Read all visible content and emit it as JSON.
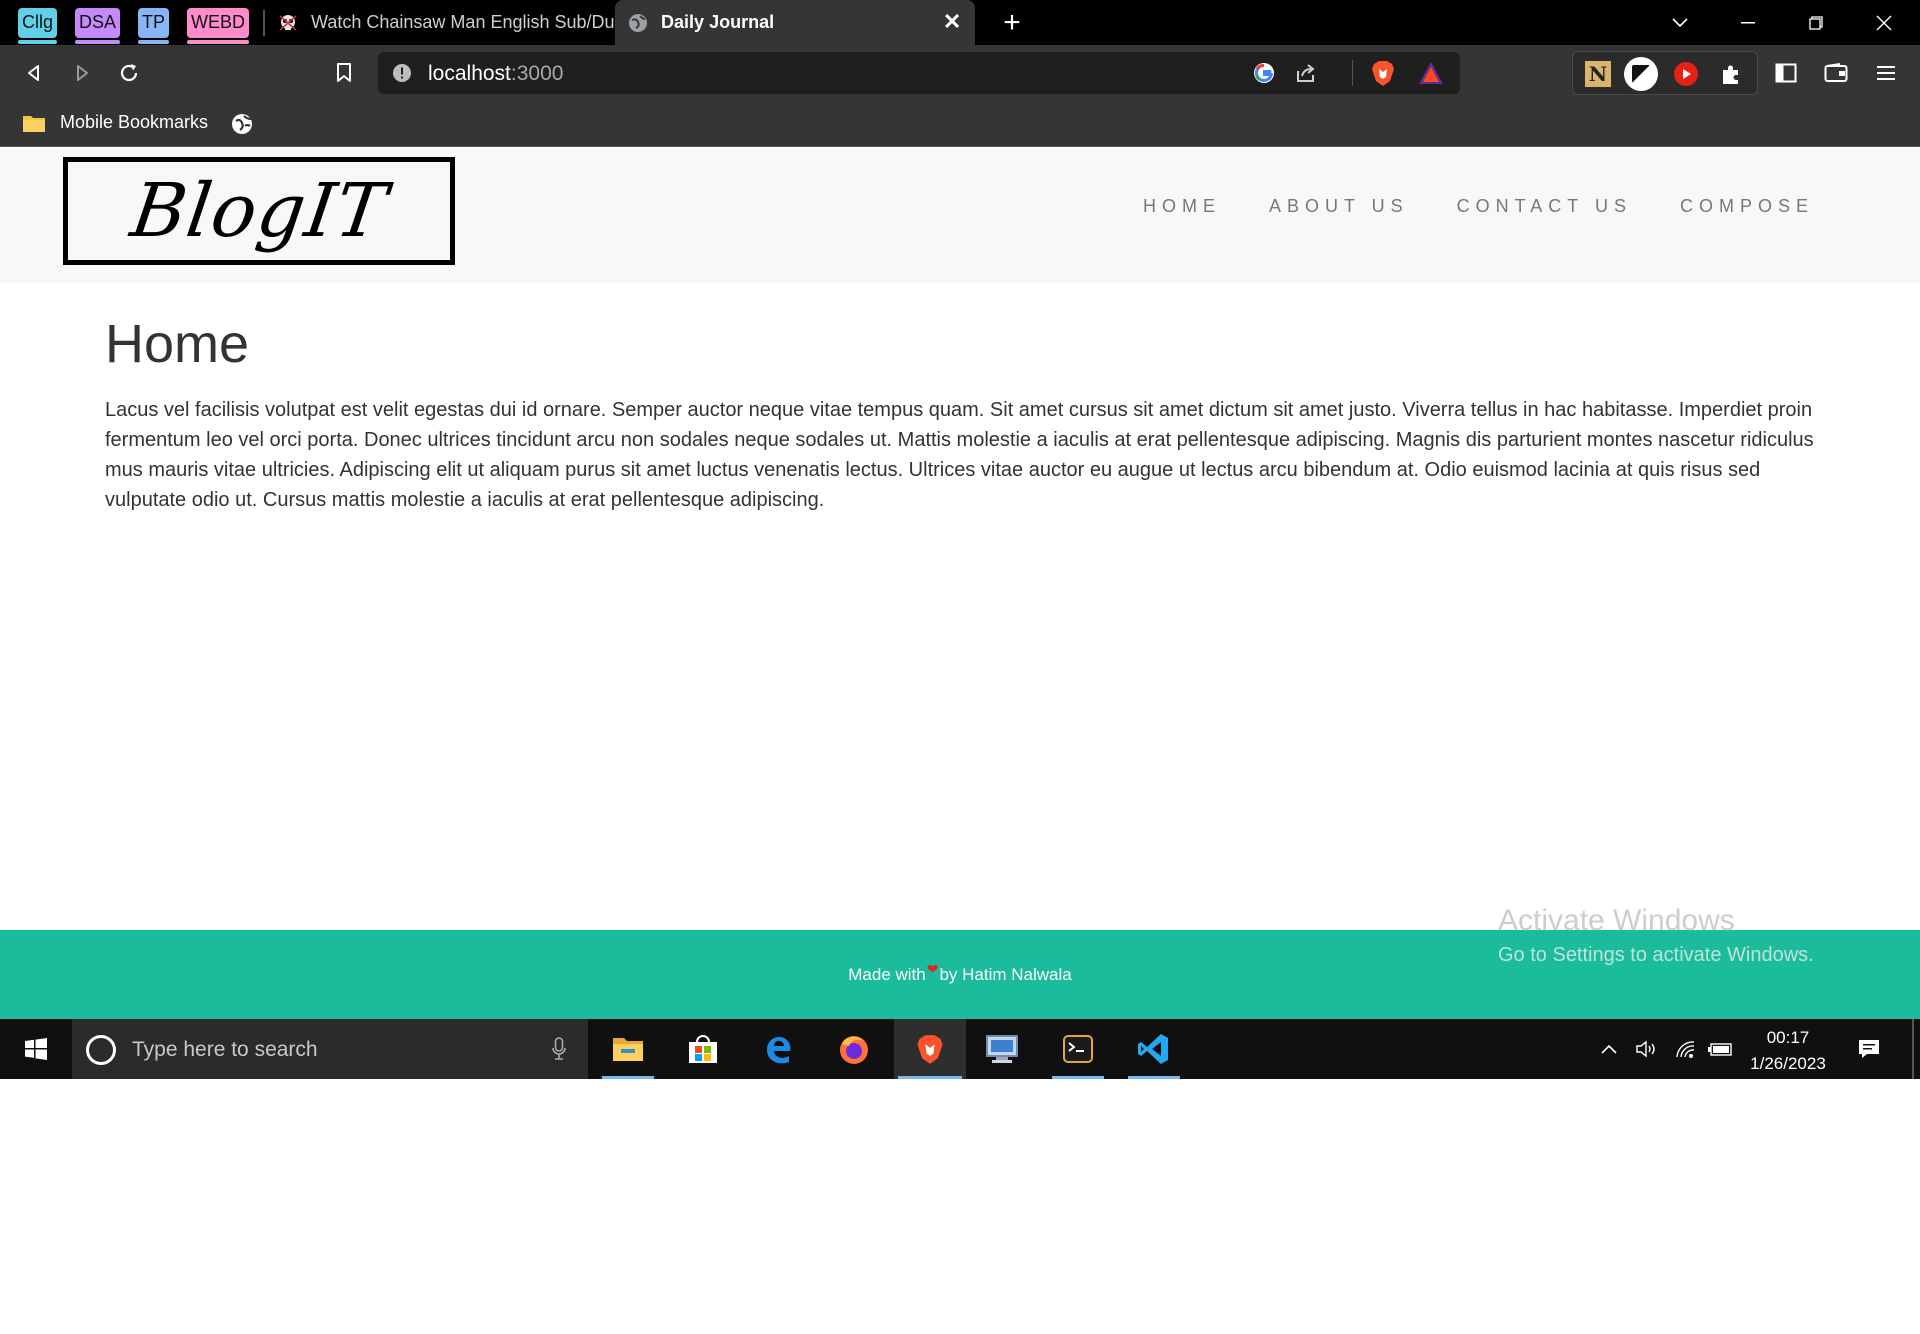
{
  "browser": {
    "tab_groups": [
      {
        "label": "Cllg",
        "color": "#5fd0e8"
      },
      {
        "label": "DSA",
        "color": "#c58af9"
      },
      {
        "label": "TP",
        "color": "#8ab4f8"
      },
      {
        "label": "WEBD",
        "color": "#ff8bcb"
      }
    ],
    "tabs": [
      {
        "title": "Watch Chainsaw Man English Sub/Dub",
        "active": false
      },
      {
        "title": "Daily Journal",
        "active": true
      }
    ],
    "address": {
      "host": "localhost",
      "port": ":3000"
    },
    "bookmarks": [
      {
        "label": "Mobile Bookmarks"
      }
    ]
  },
  "page": {
    "brand": "BlogIT",
    "nav": {
      "home": "HOME",
      "about": "ABOUT US",
      "contact": "CONTACT US",
      "compose": "COMPOSE"
    },
    "title": "Home",
    "body": "Lacus vel facilisis volutpat est velit egestas dui id ornare. Semper auctor neque vitae tempus quam. Sit amet cursus sit amet dictum sit amet justo. Viverra tellus in hac habitasse. Imperdiet proin fermentum leo vel orci porta. Donec ultrices tincidunt arcu non sodales neque sodales ut. Mattis molestie a iaculis at erat pellentesque adipiscing. Magnis dis parturient montes nascetur ridiculus mus mauris vitae ultricies. Adipiscing elit ut aliquam purus sit amet luctus venenatis lectus. Ultrices vitae auctor eu augue ut lectus arcu bibendum at. Odio euismod lacinia at quis risus sed vulputate odio ut. Cursus mattis molestie a iaculis at erat pellentesque adipiscing.",
    "footer": {
      "before": "Made with",
      "after": "by Hatim Nalwala"
    },
    "footer_color": "#1abc9c"
  },
  "watermark": {
    "line1": "Activate Windows",
    "line2": "Go to Settings to activate Windows."
  },
  "taskbar": {
    "search_placeholder": "Type here to search",
    "time": "00:17",
    "date": "1/26/2023"
  }
}
